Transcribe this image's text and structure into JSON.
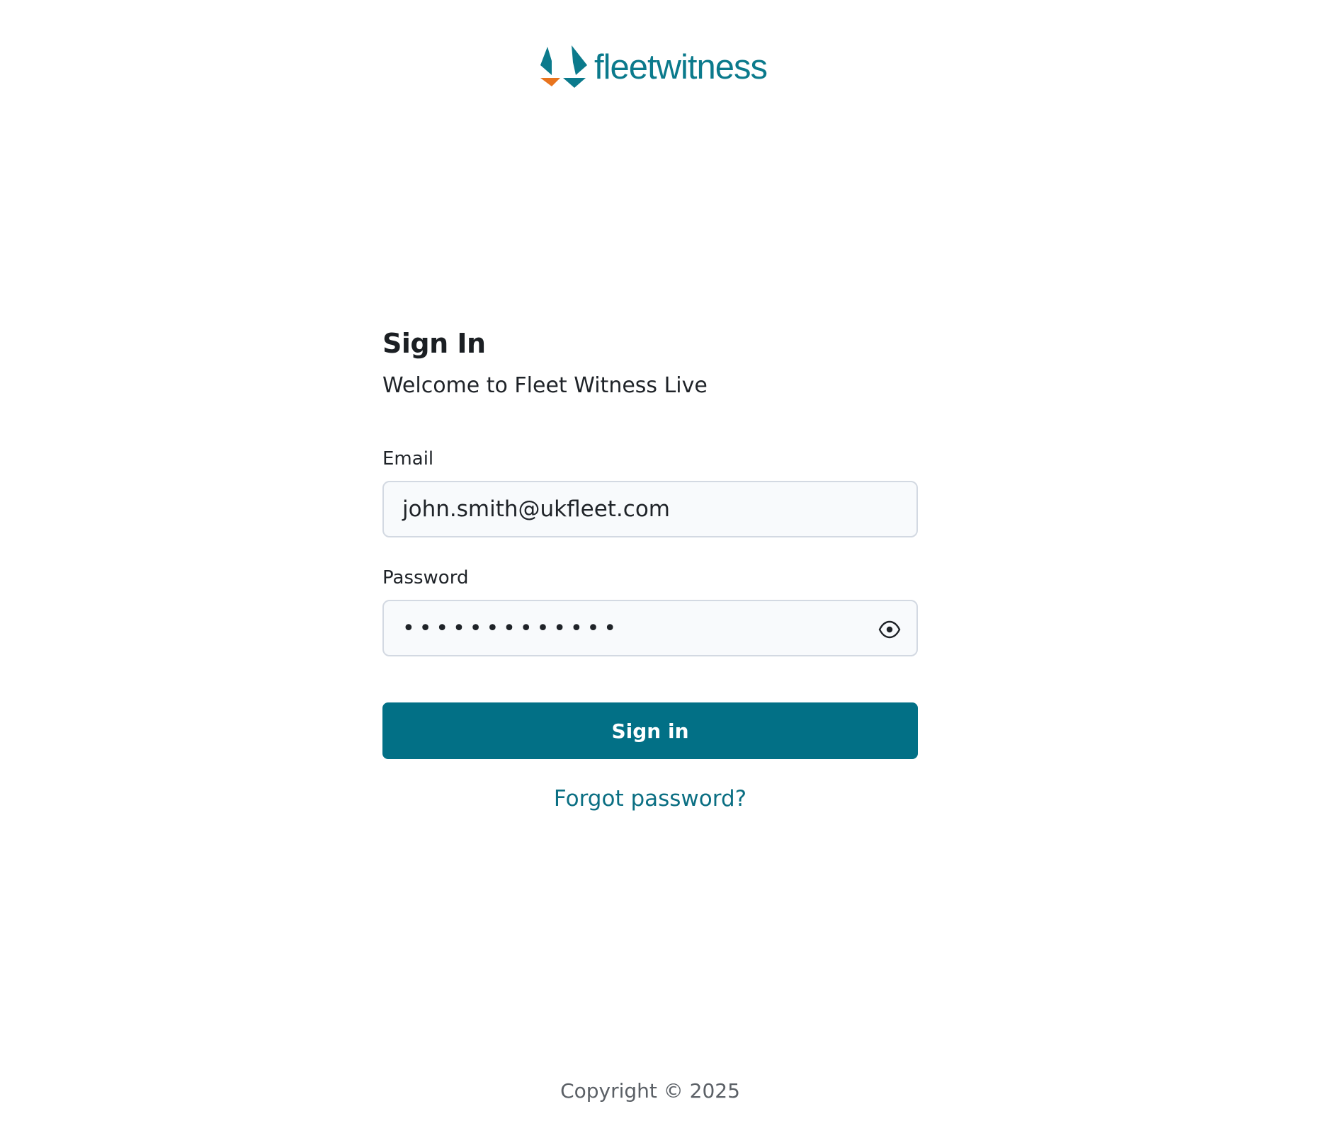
{
  "brand": {
    "name": "fleetwitness",
    "logo_icon": "fleetwitness-logo-icon",
    "colors": {
      "teal": "#0b7a8c",
      "orange": "#e8741e",
      "button": "#027086"
    }
  },
  "form": {
    "title": "Sign In",
    "subtitle": "Welcome to Fleet Witness Live",
    "email": {
      "label": "Email",
      "value": "john.smith@ukfleet.com"
    },
    "password": {
      "label": "Password",
      "masked_value": "•••••••••••••",
      "toggle_icon": "eye-icon"
    },
    "submit_label": "Sign in",
    "forgot_label": "Forgot password?"
  },
  "footer": {
    "copyright": "Copyright © 2025"
  }
}
